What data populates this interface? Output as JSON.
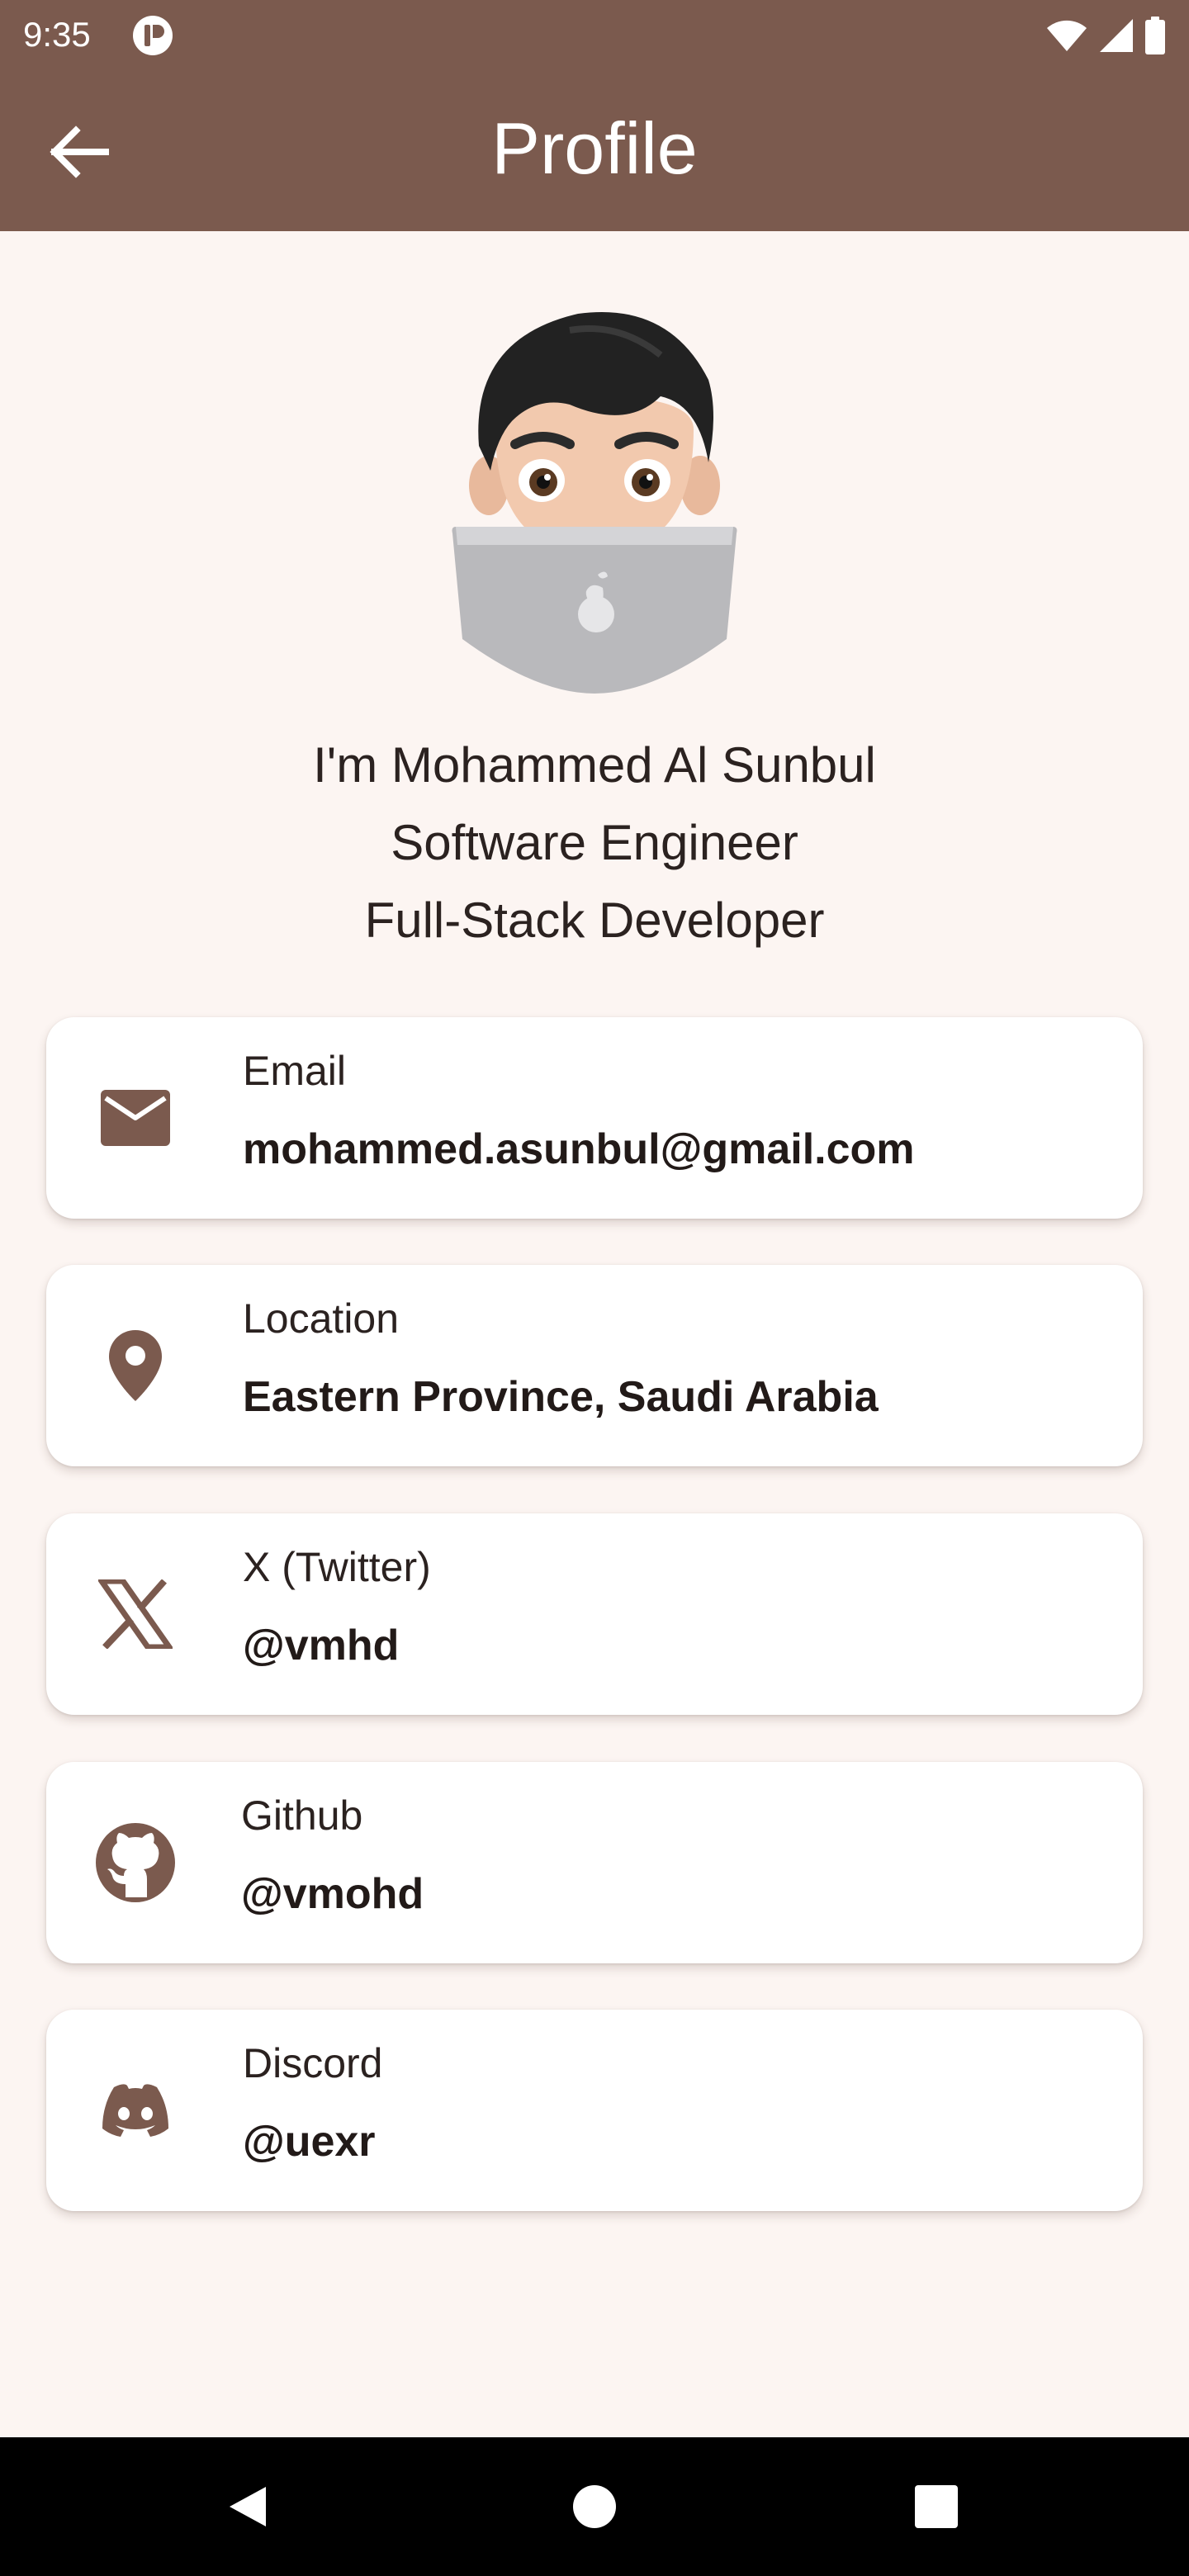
{
  "status_bar": {
    "time": "9:35"
  },
  "app_bar": {
    "title": "Profile",
    "background": "#7b5a4e"
  },
  "profile": {
    "intro_lines": [
      "I'm Mohammed Al Sunbul",
      "Software Engineer",
      "Full-Stack Developer"
    ]
  },
  "contacts": [
    {
      "icon": "email-icon",
      "label": "Email",
      "value": "mohammed.asunbul@gmail.com"
    },
    {
      "icon": "location-pin-icon",
      "label": "Location",
      "value": "Eastern Province, Saudi Arabia"
    },
    {
      "icon": "x-logo-icon",
      "label": "X (Twitter)",
      "value": "@vmhd"
    },
    {
      "icon": "github-icon",
      "label": "Github",
      "value": "@vmohd"
    },
    {
      "icon": "discord-icon",
      "label": "Discord",
      "value": "@uexr"
    }
  ],
  "colors": {
    "accent": "#7b5a4e",
    "page_background": "#fcf5f2",
    "card_background": "#ffffff",
    "icon_color": "#7b5a4e"
  }
}
